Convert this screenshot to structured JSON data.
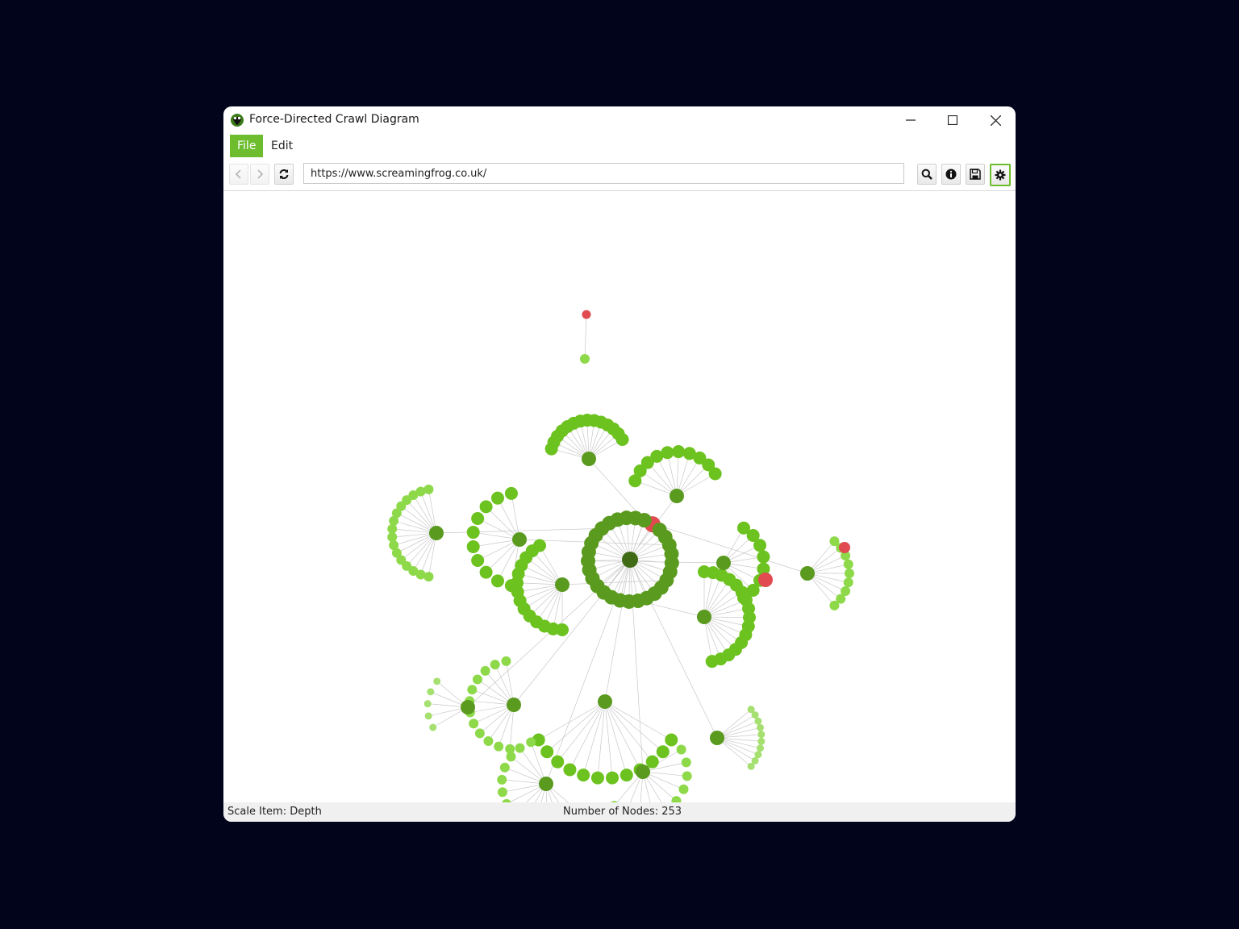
{
  "window": {
    "title": "Force-Directed Crawl Diagram",
    "icon": "frog-icon"
  },
  "menu": {
    "items": [
      {
        "label": "File",
        "active": true
      },
      {
        "label": "Edit",
        "active": false
      }
    ]
  },
  "toolbar": {
    "url": "https://www.screamingfrog.co.uk/",
    "buttons": [
      "back-icon",
      "forward-icon",
      "refresh-icon",
      "search-icon",
      "info-icon",
      "save-icon",
      "settings-icon"
    ]
  },
  "status": {
    "scale_item": "Scale Item: Depth",
    "node_count": "Number of Nodes: 253"
  },
  "colors": {
    "background": "#02041b",
    "accent": "#6dbd2f",
    "depth0": "#3f6b16",
    "depth1": "#5a9a1f",
    "depth2": "#6cc21e",
    "depth3": "#8ed94a",
    "depth4": "#a5e070",
    "error": "#e04a50",
    "edge": "#c8c8c8"
  }
}
